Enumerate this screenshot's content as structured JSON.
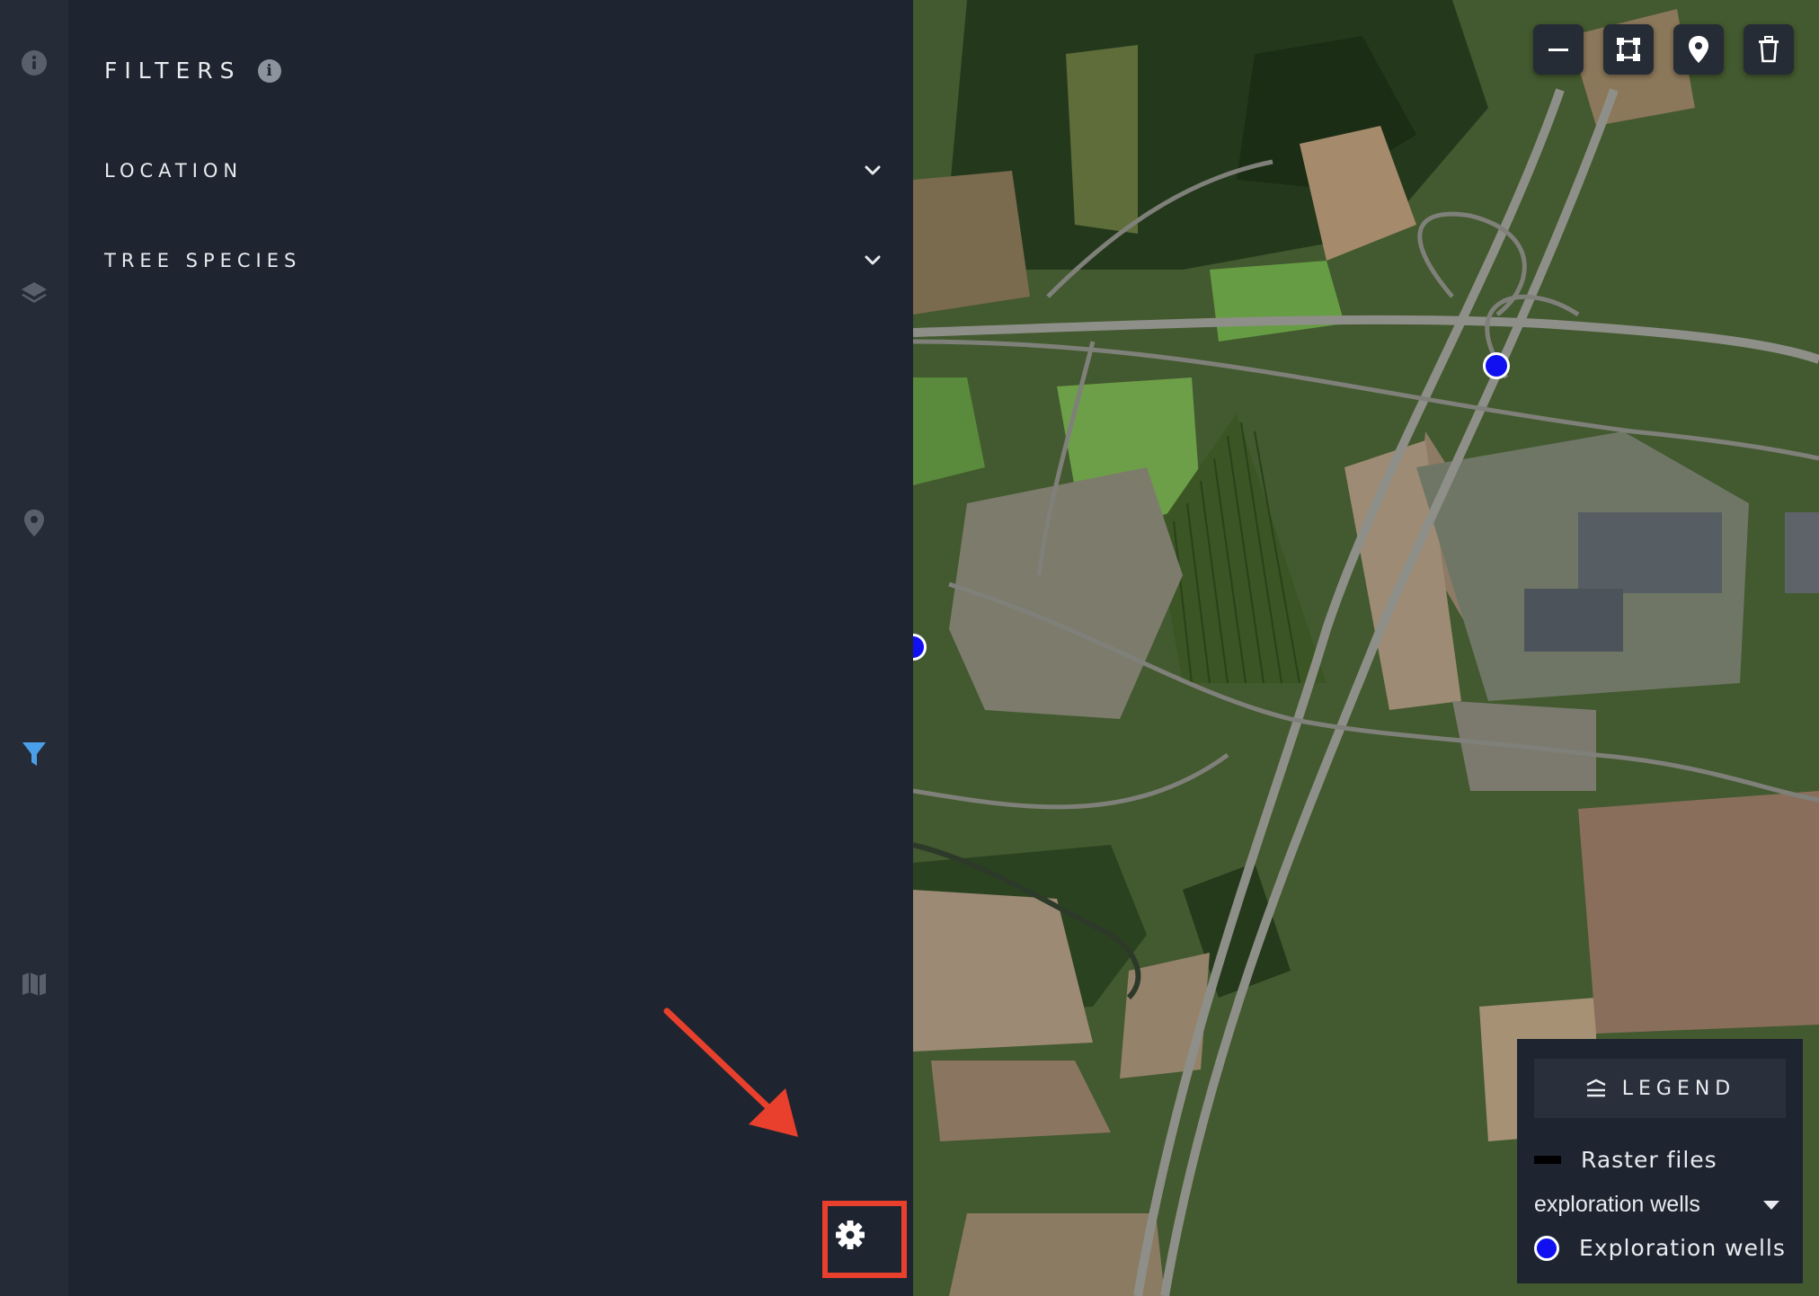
{
  "rail": {
    "items": [
      {
        "icon": "info-icon"
      },
      {
        "icon": "layers-icon"
      },
      {
        "icon": "location-pin-icon"
      },
      {
        "icon": "filter-icon",
        "active": true
      },
      {
        "icon": "map-icon"
      }
    ],
    "active_color": "#4a9fe8",
    "inactive_color": "#58606c"
  },
  "panel": {
    "title": "FILTERS",
    "title_info_glyph": "i",
    "sections": [
      {
        "label": "LOCATION"
      },
      {
        "label": "TREE SPECIES"
      }
    ]
  },
  "map": {
    "tools": [
      {
        "icon": "minus-icon"
      },
      {
        "icon": "polygon-select-icon"
      },
      {
        "icon": "marker-icon"
      },
      {
        "icon": "trash-icon"
      }
    ]
  },
  "legend": {
    "title": "LEGEND",
    "rows": {
      "raster": "Raster files",
      "selector": "exploration wells",
      "wells": "Exploration wells"
    },
    "well_color": "#1010f0"
  },
  "annotation": {
    "color": "#e8402c"
  }
}
